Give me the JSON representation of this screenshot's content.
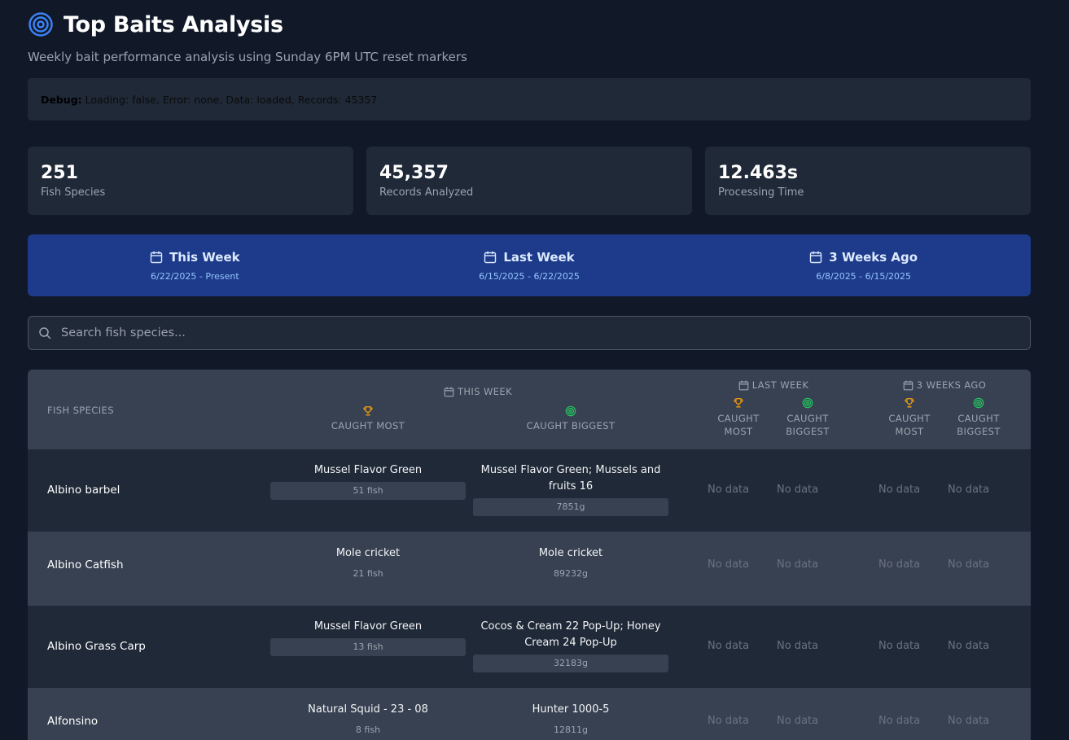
{
  "page": {
    "title": "Top Baits Analysis",
    "subtitle": "Weekly bait performance analysis using Sunday 6PM UTC reset markers"
  },
  "debug": {
    "label": "Debug:",
    "text": "Loading: false, Error: none, Data: loaded, Records: 45357"
  },
  "stats": [
    {
      "value": "251",
      "label": "Fish Species"
    },
    {
      "value": "45,357",
      "label": "Records Analyzed"
    },
    {
      "value": "12.463s",
      "label": "Processing Time"
    }
  ],
  "weeks": [
    {
      "name": "This Week",
      "range": "6/22/2025 - Present"
    },
    {
      "name": "Last Week",
      "range": "6/15/2025 - 6/22/2025"
    },
    {
      "name": "3 Weeks Ago",
      "range": "6/8/2025 - 6/15/2025"
    }
  ],
  "search": {
    "placeholder": "Search fish species..."
  },
  "table": {
    "species_header": "FISH SPECIES",
    "groups": [
      "THIS WEEK",
      "LAST WEEK",
      "3 WEEKS AGO"
    ],
    "caught_most": "CAUGHT MOST",
    "caught_biggest": "CAUGHT BIGGEST",
    "caught": "CAUGHT",
    "most": "MOST",
    "biggest": "BIGGEST",
    "no_data": "No data",
    "rows": [
      {
        "species": "Albino barbel",
        "most_bait": "Mussel Flavor Green",
        "most_count": "51 fish",
        "big_bait": "Mussel Flavor Green; Mussels and fruits 16",
        "big_weight": "7851g"
      },
      {
        "species": "Albino Catfish",
        "most_bait": "Mole cricket",
        "most_count": "21 fish",
        "big_bait": "Mole cricket",
        "big_weight": "89232g"
      },
      {
        "species": "Albino Grass Carp",
        "most_bait": "Mussel Flavor Green",
        "most_count": "13 fish",
        "big_bait": "Cocos & Cream 22 Pop-Up; Honey Cream 24 Pop-Up",
        "big_weight": "32183g"
      },
      {
        "species": "Alfonsino",
        "most_bait": "Natural Squid - 23 - 08",
        "most_count": "8 fish",
        "big_bait": "Hunter 1000-5",
        "big_weight": "12811g"
      }
    ]
  },
  "colors": {
    "background": "#111827",
    "card": "#1f2937",
    "week_bar": "#1e3a8a",
    "trophy": "#f59e0b",
    "target_green": "#22c55e",
    "title_icon": "#3b82f6"
  }
}
